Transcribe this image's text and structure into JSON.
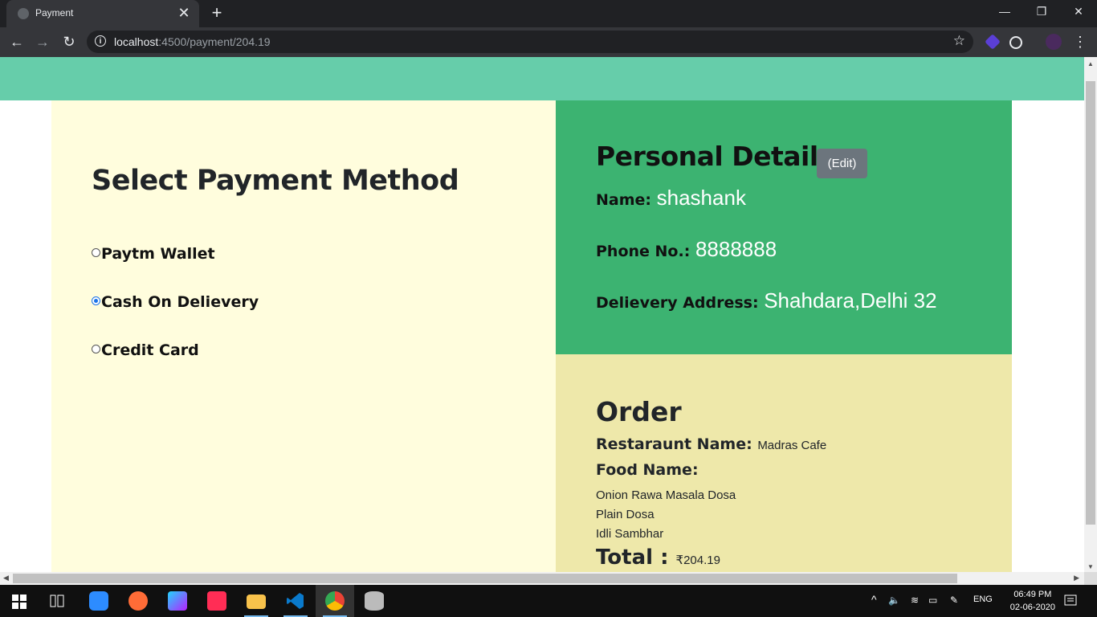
{
  "browser": {
    "tab_title": "Payment",
    "tab_close": "✕",
    "new_tab": "+",
    "url_host": "localhost",
    "url_rest": ":4500/payment/204.19",
    "minimize": "—",
    "restore": "❐",
    "close": "✕",
    "back": "←",
    "forward": "→",
    "reload": "↻",
    "star": "☆",
    "menu": "⋮"
  },
  "payment": {
    "heading": "Select Payment Method",
    "options": [
      {
        "label": "Paytm Wallet",
        "checked": false
      },
      {
        "label": "Cash On Delievery",
        "checked": true
      },
      {
        "label": "Credit Card",
        "checked": false
      }
    ]
  },
  "personal": {
    "heading": "Personal Details",
    "edit_label": "(Edit)",
    "name_label": "Name:",
    "name_value": "shashank",
    "phone_label": "Phone No.:",
    "phone_value": "8888888",
    "address_label": "Delievery Address:",
    "address_value": "Shahdara,Delhi 32"
  },
  "order": {
    "heading": "Order",
    "restaurant_label": "Restaraunt Name:",
    "restaurant_value": "Madras Cafe",
    "food_label": "Food Name:",
    "foods": [
      "Onion Rawa Masala Dosa",
      "Plain Dosa",
      "Idli Sambhar"
    ],
    "total_label": "Total :",
    "total_value": "₹204.19"
  },
  "taskbar": {
    "lang": "ENG",
    "time": "06:49 PM",
    "date": "02-06-2020"
  },
  "colors": {
    "banner": "#66cdaa",
    "left_panel": "#fffddd",
    "personal_panel": "#3cb371",
    "order_panel": "#eee8aa",
    "edit_button": "#6c757d"
  }
}
